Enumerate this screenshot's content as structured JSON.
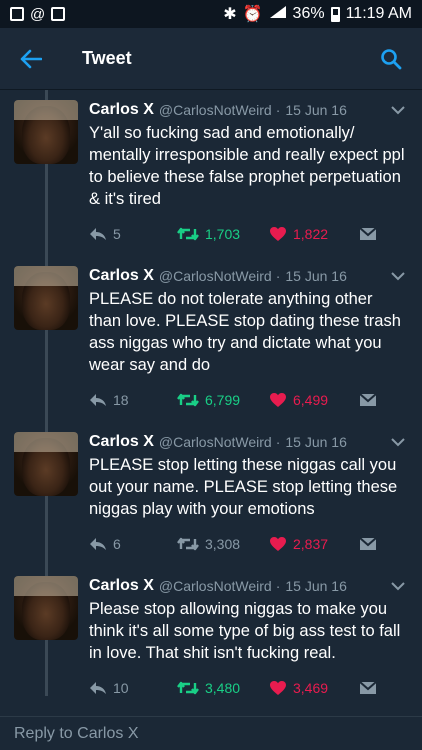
{
  "status_bar": {
    "time": "11:19 AM",
    "battery": "36%",
    "icons": [
      "bluetooth-icon",
      "alarm-icon",
      "signal-icon",
      "battery-icon"
    ]
  },
  "app_bar": {
    "title": "Tweet"
  },
  "tweets": [
    {
      "name": "Carlos X",
      "handle": "@CarlosNotWeird",
      "dot": "·",
      "date": "15 Jun 16",
      "text": "Y'all so fucking sad and emotionally/ mentally irresponsible and really expect ppl to believe these false prophet perpetuation & it's tired",
      "replies": "5",
      "retweets": "1,703",
      "likes": "1,822",
      "retweeted": true
    },
    {
      "name": "Carlos X",
      "handle": "@CarlosNotWeird",
      "dot": "·",
      "date": "15 Jun 16",
      "text": "PLEASE do not tolerate anything other than love. PLEASE stop dating these trash ass niggas who try and dictate what you wear say and do",
      "replies": "18",
      "retweets": "6,799",
      "likes": "6,499",
      "retweeted": true
    },
    {
      "name": "Carlos X",
      "handle": "@CarlosNotWeird",
      "dot": "·",
      "date": "15 Jun 16",
      "text": "PLEASE stop letting these niggas call you out your name. PLEASE stop letting these niggas play with your emotions",
      "replies": "6",
      "retweets": "3,308",
      "likes": "2,837",
      "retweeted": false
    },
    {
      "name": "Carlos X",
      "handle": "@CarlosNotWeird",
      "dot": "·",
      "date": "15 Jun 16",
      "text": "Please stop allowing niggas to make you think it's all some type of big ass test to fall in love. That shit isn't fucking real.",
      "replies": "10",
      "retweets": "3,480",
      "likes": "3,469",
      "retweeted": true
    }
  ],
  "reply_bar": {
    "placeholder": "Reply to Carlos X"
  },
  "colors": {
    "background": "#1b2836",
    "retweet_green": "#19cf86",
    "like_red": "#e81c4f",
    "accent_blue": "#1da1f2",
    "muted": "#8899a6"
  }
}
